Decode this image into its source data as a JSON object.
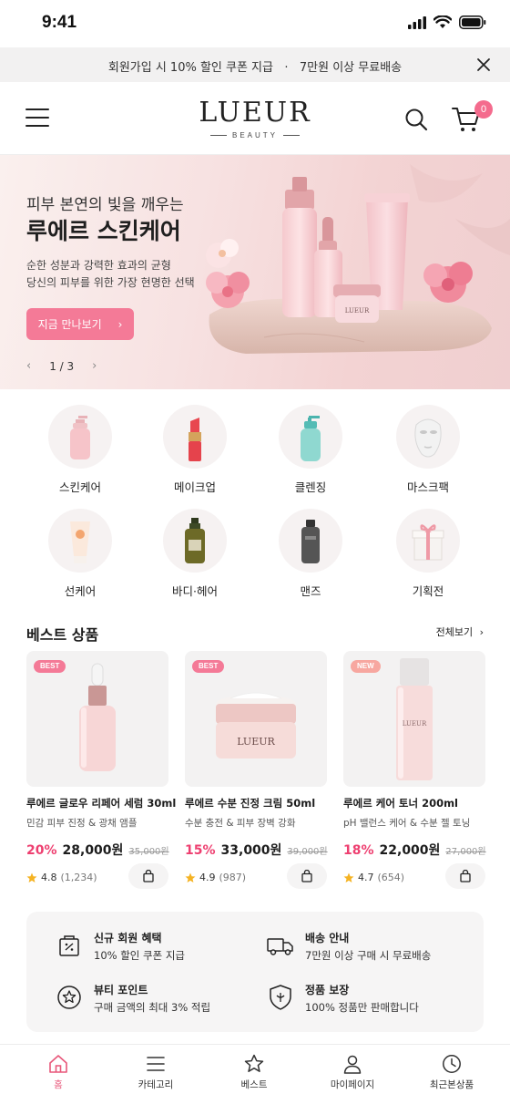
{
  "status_bar": {
    "time": "9:41"
  },
  "promo": {
    "text": "회원가입 시 10% 할인 쿠폰 지급   ·   7만원 이상 무료배송"
  },
  "header": {
    "logo": "LUEUR",
    "logo_sub": "BEAUTY",
    "cart_count": "0"
  },
  "hero": {
    "eyebrow": "피부 본연의 빛을 깨우는",
    "title": "루에르 스킨케어",
    "desc_line1": "순한 성분과 강력한 효과의 균형",
    "desc_line2": "당신의 피부를 위한 가장 현명한 선택",
    "cta": "지금 만나보기",
    "cta_arrow": "›",
    "pager": "1 / 3",
    "prev": "‹",
    "next": "›",
    "product_label": "LUEUR"
  },
  "categories": [
    {
      "label": "스킨케어",
      "icon": "pump-bottle-icon"
    },
    {
      "label": "메이크업",
      "icon": "lipstick-icon"
    },
    {
      "label": "클렌징",
      "icon": "cleanser-bottle-icon"
    },
    {
      "label": "마스크팩",
      "icon": "face-mask-icon"
    },
    {
      "label": "선케어",
      "icon": "sunscreen-tube-icon"
    },
    {
      "label": "바디·헤어",
      "icon": "body-bottle-icon"
    },
    {
      "label": "맨즈",
      "icon": "mens-bottle-icon"
    },
    {
      "label": "기획전",
      "icon": "gift-box-icon"
    }
  ],
  "best": {
    "title": "베스트 상품",
    "more": "전체보기",
    "more_arrow": "›",
    "products": [
      {
        "tag": "BEST",
        "name": "루에르 글로우 리페어 세럼 30ml",
        "sub": "민감 피부 진정 & 광채 앰플",
        "discount": "20%",
        "price": "28,000원",
        "original": "35,000원",
        "rating": "4.8",
        "reviews": "(1,234)"
      },
      {
        "tag": "BEST",
        "name": "루에르 수분 진정 크림 50ml",
        "sub": "수분 충전 & 피부 장벽 강화",
        "discount": "15%",
        "price": "33,000원",
        "original": "39,000원",
        "rating": "4.9",
        "reviews": "(987)",
        "jar_label": "LUEUR"
      },
      {
        "tag": "NEW",
        "name": "루에르 케어 토너 200ml",
        "sub": "pH 밸런스 케어 & 수분 젤 토닝",
        "discount": "18%",
        "price": "22,000원",
        "original": "27,000원",
        "rating": "4.7",
        "reviews": "(654)",
        "bottle_label": "LUEUR"
      }
    ]
  },
  "benefits": [
    {
      "title": "신규 회원 혜택",
      "desc": "10% 할인 쿠폰 지급",
      "icon": "coupon-bag-icon"
    },
    {
      "title": "배송 안내",
      "desc": "7만원 이상 구매 시 무료배송",
      "icon": "truck-icon"
    },
    {
      "title": "뷰티 포인트",
      "desc": "구매 금액의 최대 3% 적립",
      "icon": "star-badge-icon"
    },
    {
      "title": "정품 보장",
      "desc": "100% 정품만 판매합니다",
      "icon": "shield-icon"
    }
  ],
  "tabbar": [
    {
      "label": "홈",
      "icon": "home-icon",
      "active": true
    },
    {
      "label": "카테고리",
      "icon": "menu-icon",
      "active": false
    },
    {
      "label": "베스트",
      "icon": "star-icon",
      "active": false
    },
    {
      "label": "마이페이지",
      "icon": "user-icon",
      "active": false
    },
    {
      "label": "최근본상품",
      "icon": "clock-icon",
      "active": false
    }
  ],
  "colors": {
    "accent": "#f47a97",
    "discount": "#ee3f70",
    "active_tab": "#e8577a",
    "star": "#f5b323"
  }
}
